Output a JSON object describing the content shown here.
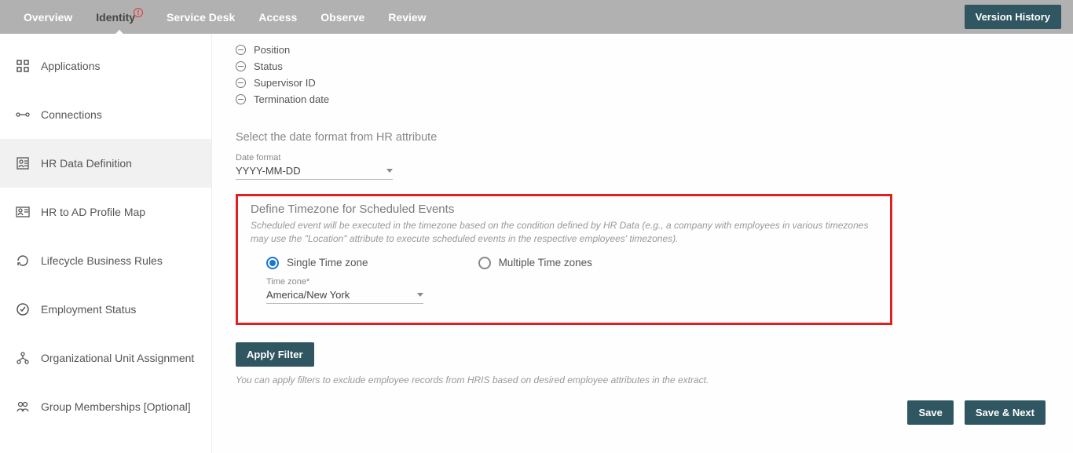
{
  "topnav": {
    "items": [
      {
        "label": "Overview"
      },
      {
        "label": "Identity",
        "active": true,
        "badge": "!"
      },
      {
        "label": "Service Desk"
      },
      {
        "label": "Access"
      },
      {
        "label": "Observe"
      },
      {
        "label": "Review"
      }
    ],
    "version_history": "Version History"
  },
  "sidebar": {
    "items": [
      {
        "label": "Applications",
        "icon": "apps-icon"
      },
      {
        "label": "Connections",
        "icon": "connections-icon"
      },
      {
        "label": "HR Data Definition",
        "icon": "hr-data-icon",
        "active": true
      },
      {
        "label": "HR to AD Profile Map",
        "icon": "profile-map-icon"
      },
      {
        "label": "Lifecycle Business Rules",
        "icon": "lifecycle-icon"
      },
      {
        "label": "Employment Status",
        "icon": "status-icon"
      },
      {
        "label": "Organizational Unit Assignment",
        "icon": "orgunit-icon"
      },
      {
        "label": "Group Memberships [Optional]",
        "icon": "group-icon"
      }
    ]
  },
  "attributes": [
    "Position",
    "Status",
    "Supervisor ID",
    "Termination date"
  ],
  "dateformat": {
    "prompt": "Select the date format from HR attribute",
    "label": "Date format",
    "value": "YYYY-MM-DD"
  },
  "timezone": {
    "title": "Define Timezone for Scheduled Events",
    "desc": "Scheduled event will be executed in the timezone based on the condition defined by HR Data (e.g., a company with employees in various timezones may use the \"Location\" attribute to execute scheduled events in the respective employees' timezones).",
    "options": {
      "single": "Single Time zone",
      "multiple": "Multiple Time zones"
    },
    "field_label": "Time zone*",
    "field_value": "America/New York"
  },
  "filter": {
    "button": "Apply Filter",
    "desc": "You can apply filters to exclude employee records from HRIS based on desired employee attributes in the extract."
  },
  "footer": {
    "save": "Save",
    "save_next": "Save & Next"
  }
}
